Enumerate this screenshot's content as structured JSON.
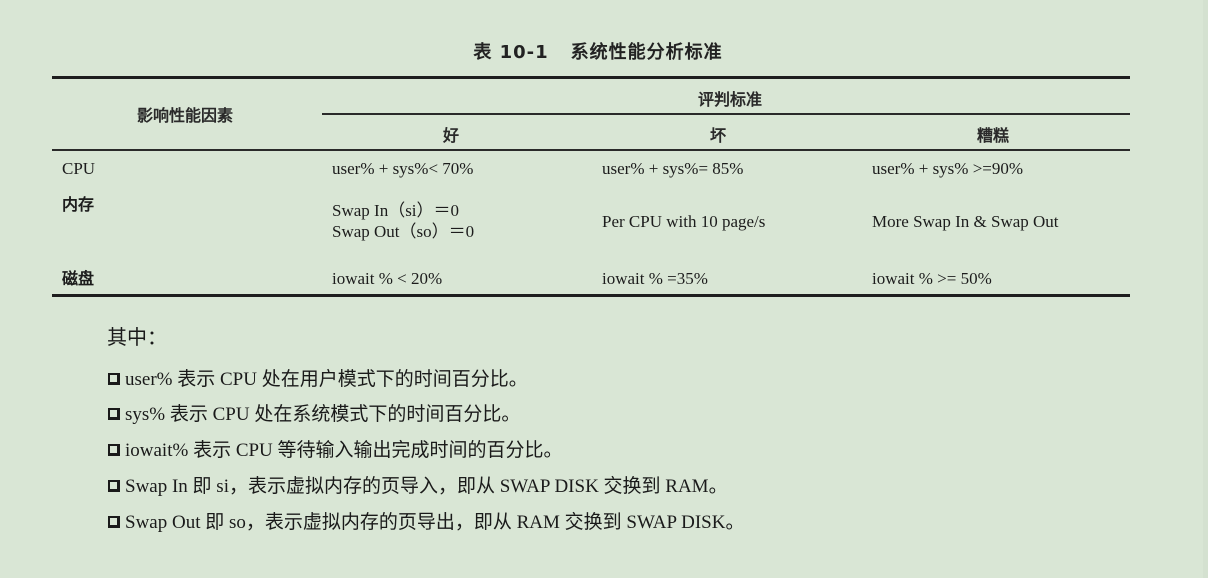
{
  "table": {
    "number": "表 10-1",
    "title": "系统性能分析标准",
    "header": {
      "factor": "影响性能因素",
      "criteria_group": "评判标准",
      "columns": [
        "好",
        "坏",
        "糟糕"
      ]
    },
    "rows": [
      {
        "factor": "CPU",
        "good": [
          "user% + sys%< 70%"
        ],
        "bad": "user% + sys%= 85%",
        "terrible": "user% + sys% >=90%"
      },
      {
        "factor": "内存",
        "good": [
          "Swap In（si）＝0",
          "Swap Out（so）＝0"
        ],
        "bad": "Per CPU with 10 page/s",
        "terrible": "More Swap In & Swap Out"
      },
      {
        "factor": "磁盘",
        "good": [
          "iowait % < 20%"
        ],
        "bad": "iowait % =35%",
        "terrible": "iowait % >= 50%"
      }
    ]
  },
  "notes": {
    "intro": "其中：",
    "bullet_icon": "checkbox-square-icon",
    "items": [
      "user% 表示 CPU 处在用户模式下的时间百分比。",
      "sys% 表示 CPU 处在系统模式下的时间百分比。",
      "iowait% 表示 CPU 等待输入输出完成时间的百分比。",
      "Swap In 即 si，表示虚拟内存的页导入，即从 SWAP DISK 交换到 RAM。",
      "Swap Out 即 so，表示虚拟内存的页导出，即从 RAM 交换到 SWAP DISK。"
    ]
  }
}
